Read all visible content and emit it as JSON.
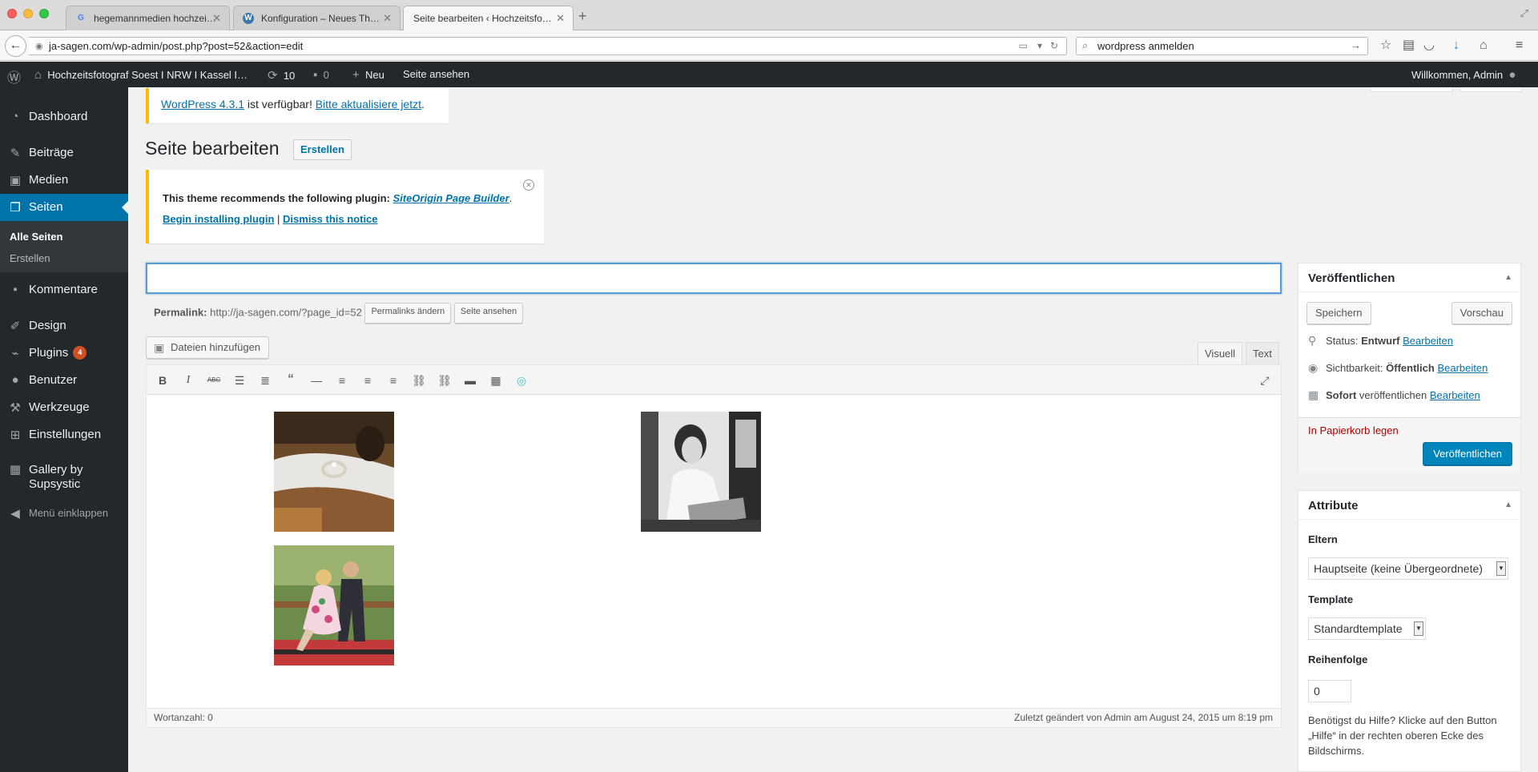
{
  "browser": {
    "tabs": [
      {
        "title": "hegemannmedien hochzei…",
        "favicon": "G"
      },
      {
        "title": "Konfiguration – Neues Th…",
        "favicon": "W"
      },
      {
        "title": "Seite bearbeiten ‹ Hochzeitsfo…"
      }
    ],
    "new_tab": "+",
    "url": "ja-sagen.com/wp-admin/post.php?post=52&action=edit",
    "search": "wordpress anmelden"
  },
  "adminbar": {
    "site_name": "Hochzeitsfotograf Soest I NRW I Kassel I…",
    "updates": "10",
    "comments": "0",
    "new": "Neu",
    "view_site": "Seite ansehen",
    "greeting": "Willkommen, Admin"
  },
  "sidebar": {
    "items": [
      {
        "label": "Dashboard",
        "icon": "dashboard-icon"
      },
      {
        "label": "Beiträge",
        "icon": "pin-icon"
      },
      {
        "label": "Medien",
        "icon": "media-icon"
      },
      {
        "label": "Seiten",
        "icon": "pages-icon"
      },
      {
        "label": "Kommentare",
        "icon": "comment-icon"
      },
      {
        "label": "Design",
        "icon": "brush-icon"
      },
      {
        "label": "Plugins",
        "icon": "plugin-icon",
        "badge": "4"
      },
      {
        "label": "Benutzer",
        "icon": "user-icon"
      },
      {
        "label": "Werkzeuge",
        "icon": "wrench-icon"
      },
      {
        "label": "Einstellungen",
        "icon": "settings-icon"
      },
      {
        "label": "Gallery by Supsystic",
        "icon": "gallery-icon"
      }
    ],
    "submenu": [
      "Alle Seiten",
      "Erstellen"
    ],
    "collapse": "Menü einklappen"
  },
  "update_notice": {
    "link1": "WordPress 4.3.1",
    "text": " ist verfügbar! ",
    "link2": "Bitte aktualisiere jetzt",
    "end": "."
  },
  "page": {
    "title": "Seite bearbeiten",
    "create_button": "Erstellen"
  },
  "plugin_notice": {
    "text": "This theme recommends the following plugin: ",
    "plugin_link": "SiteOrigin Page Builder",
    "install_link": "Begin installing plugin",
    "separator": "|",
    "dismiss_link": "Dismiss this notice"
  },
  "editor": {
    "title_value": "",
    "permalink_label": "Permalink:",
    "permalink_url": "http://ja-sagen.com/?page_id=52",
    "permalink_change": "Permalinks ändern",
    "permalink_view": "Seite ansehen",
    "add_media": "Dateien hinzufügen",
    "tab_visual": "Visuell",
    "tab_text": "Text",
    "word_count": "Wortanzahl: 0",
    "last_edited": "Zuletzt geändert von Admin am August 24, 2015 um 8:19 pm"
  },
  "publish": {
    "title": "Veröffentlichen",
    "save": "Speichern",
    "preview": "Vorschau",
    "status_label": "Status: ",
    "status_value": "Entwurf",
    "visibility_label": "Sichtbarkeit: ",
    "visibility_value": "Öffentlich",
    "schedule_value": "Sofort",
    "schedule_label": " veröffentlichen",
    "edit_link": "Bearbeiten",
    "trash": "In Papierkorb legen",
    "publish_button": "Veröffentlichen"
  },
  "attributes": {
    "title": "Attribute",
    "parent_label": "Eltern",
    "parent_value": "Hauptseite (keine Übergeordnete)",
    "template_label": "Template",
    "template_value": "Standardtemplate",
    "order_label": "Reihenfolge",
    "order_value": "0",
    "help": "Benötigst du Hilfe? Klicke auf den Button „Hilfe“ in der rechten oberen Ecke des Bildschirms."
  },
  "colors": {
    "admin_dark": "#23282d",
    "accent_blue": "#0073aa",
    "notice_yellow": "#ffba00",
    "badge_orange": "#d54e21",
    "trash_red": "#aa0000"
  }
}
